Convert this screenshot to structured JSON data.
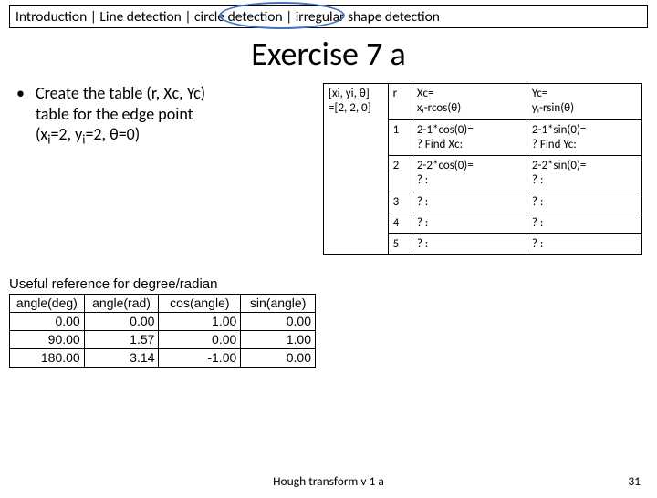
{
  "breadcrumb": {
    "text": "Introduction | Line detection | circle detection | irregular shape detection",
    "highlight_label": "circle detection"
  },
  "title": "Exercise 7 a",
  "bullet": {
    "line1": "Create the table (r, Xc, Yc)",
    "line2": "table for the edge point",
    "line3_pre": "(x",
    "line3_sub1": "i",
    "line3_mid1": "=2, y",
    "line3_sub2": "i",
    "line3_mid2": "=2, θ=0)"
  },
  "calc": {
    "a_top": "[xi, yi, θ]",
    "a_bot": "=[2, 2, 0]",
    "r_head": "r",
    "xc_head_top": "Xc=",
    "xc_head_bot": "xᵢ-rcos(θ)",
    "yc_head_top": "Yc=",
    "yc_head_bot": "yᵢ-rsin(θ)",
    "rows": [
      {
        "r": "1",
        "xc_top": "2-1*cos(0)=",
        "xc_bot": "? Find Xc:",
        "yc_top": "2-1*sin(0)=",
        "yc_bot": "? Find Yc:"
      },
      {
        "r": "2",
        "xc_top": "2-2*cos(0)=",
        "xc_bot": "? :",
        "yc_top": "2-2*sin(0)=",
        "yc_bot": "? :"
      },
      {
        "r": "3",
        "xc_top": "? :",
        "xc_bot": "",
        "yc_top": "? :",
        "yc_bot": ""
      },
      {
        "r": "4",
        "xc_top": "? :",
        "xc_bot": "",
        "yc_top": "? :",
        "yc_bot": ""
      },
      {
        "r": "5",
        "xc_top": "? :",
        "xc_bot": "",
        "yc_top": "? :",
        "yc_bot": ""
      }
    ]
  },
  "ref": {
    "caption": "Useful reference for degree/radian",
    "headers": {
      "c1": "angle(deg)",
      "c2": "angle(rad)",
      "c3": "cos(angle)",
      "c4": "sin(angle)"
    },
    "rows": [
      {
        "deg": "0.00",
        "rad": "0.00",
        "cos": "1.00",
        "sin": "0.00"
      },
      {
        "deg": "90.00",
        "rad": "1.57",
        "cos": "0.00",
        "sin": "1.00"
      },
      {
        "deg": "180.00",
        "rad": "3.14",
        "cos": "-1.00",
        "sin": "0.00"
      }
    ]
  },
  "footer": "Hough transform v 1 a",
  "page": "31"
}
